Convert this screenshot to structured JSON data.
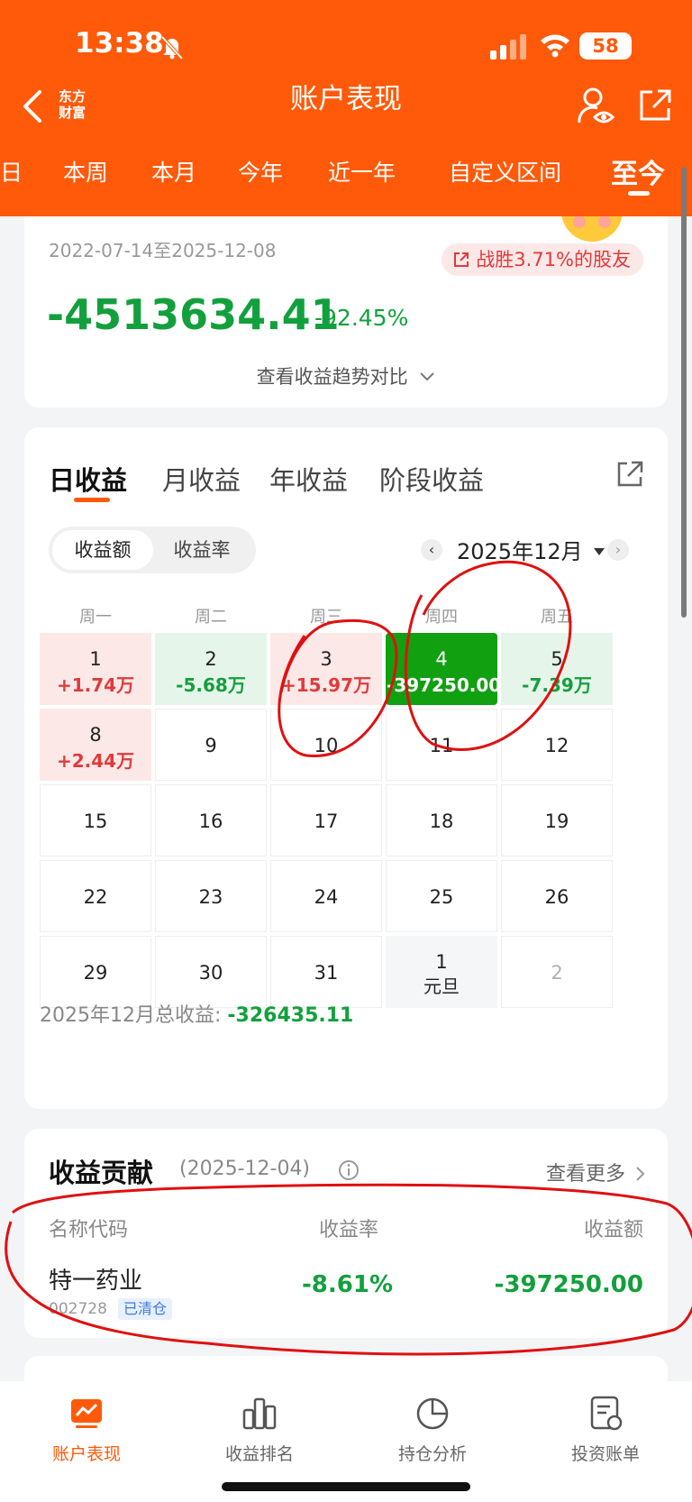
{
  "status_bar": {
    "time": "13:38",
    "battery": "58"
  },
  "header": {
    "logo_line1": "东方",
    "logo_line2": "财富",
    "title": "账户表现",
    "period_tabs": [
      "日",
      "本周",
      "本月",
      "今年",
      "近一年",
      "自定义区间",
      "至今"
    ],
    "active_period": "至今"
  },
  "summary": {
    "date_range": "2022-07-14至2025-12-08",
    "win_badge": "战胜3.71%的股友",
    "total_amount": "-4513634.41",
    "total_rate": "-92.45%",
    "trend_link": "查看收益趋势对比"
  },
  "calendar": {
    "tabs": [
      "日收益",
      "月收益",
      "年收益",
      "阶段收益"
    ],
    "active_tab": "日收益",
    "toggle": [
      "收益额",
      "收益率"
    ],
    "month_label": "2025年12月",
    "prev_arrow": "‹",
    "next_arrow": "›",
    "weekdays": [
      "周一",
      "周二",
      "周三",
      "周四",
      "周五"
    ],
    "rows": [
      [
        {
          "day": "1",
          "value": "+1.74万",
          "state": "up"
        },
        {
          "day": "2",
          "value": "-5.68万",
          "state": "down"
        },
        {
          "day": "3",
          "value": "+15.97万",
          "state": "up"
        },
        {
          "day": "4",
          "value": "-397250.00",
          "state": "selected"
        },
        {
          "day": "5",
          "value": "-7.39万",
          "state": "down"
        }
      ],
      [
        {
          "day": "8",
          "value": "+2.44万",
          "state": "up"
        },
        {
          "day": "9"
        },
        {
          "day": "10"
        },
        {
          "day": "11"
        },
        {
          "day": "12"
        }
      ],
      [
        {
          "day": "15"
        },
        {
          "day": "16"
        },
        {
          "day": "17"
        },
        {
          "day": "18"
        },
        {
          "day": "19"
        }
      ],
      [
        {
          "day": "22"
        },
        {
          "day": "23"
        },
        {
          "day": "24"
        },
        {
          "day": "25"
        },
        {
          "day": "26"
        }
      ],
      [
        {
          "day": "29"
        },
        {
          "day": "30"
        },
        {
          "day": "31"
        },
        {
          "day": "1",
          "holiday": "元旦",
          "state": "holiday"
        },
        {
          "day": "2",
          "state": "next-month"
        }
      ]
    ],
    "month_total_label": "2025年12月总收益:",
    "month_total_value": "-326435.11"
  },
  "contribution": {
    "title": "收益贡献",
    "date": "(2025-12-04)",
    "see_more": "查看更多",
    "columns": [
      "名称代码",
      "收益率",
      "收益额"
    ],
    "rows": [
      {
        "name": "特一药业",
        "code": "002728",
        "badge": "已清仓",
        "rate": "-8.61%",
        "amount": "-397250.00"
      }
    ]
  },
  "bottom_nav": [
    {
      "label": "账户表现",
      "icon": "chart-icon",
      "active": true
    },
    {
      "label": "收益排名",
      "icon": "bar-rank-icon",
      "active": false
    },
    {
      "label": "持仓分析",
      "icon": "pie-icon",
      "active": false
    },
    {
      "label": "投资账单",
      "icon": "bill-icon",
      "active": false
    }
  ],
  "colors": {
    "brand": "#ff5a0a",
    "gain": "#e03a3a",
    "loss": "#12a03c",
    "selected": "#10a010"
  }
}
